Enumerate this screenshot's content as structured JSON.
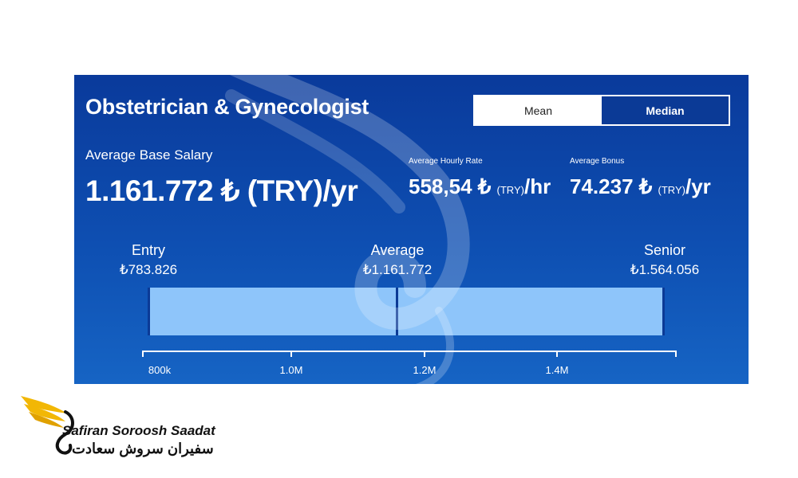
{
  "card": {
    "job_title": "Obstetrician & Gynecologist",
    "toggle": {
      "mean": "Mean",
      "median": "Median",
      "selected": "Median"
    },
    "base_salary": {
      "label": "Average Base Salary",
      "value": "1.161.772 ₺ (TRY)/yr"
    },
    "hourly": {
      "label": "Average Hourly Rate",
      "value": "558,54 ₺",
      "unit": "(TRY)",
      "suffix": "/hr"
    },
    "bonus": {
      "label": "Average Bonus",
      "value": "74.237 ₺",
      "unit": "(TRY)",
      "suffix": "/yr"
    },
    "levels": {
      "entry": {
        "label": "Entry",
        "amount": "₺783.826"
      },
      "average": {
        "label": "Average",
        "amount": "₺1.161.772"
      },
      "senior": {
        "label": "Senior",
        "amount": "₺1.564.056"
      }
    },
    "axis_ticks": [
      "800k",
      "1.0M",
      "1.2M",
      "1.4M"
    ],
    "salary_range": {
      "min": 783826,
      "average": 1161772,
      "max": 1564056
    },
    "colors": {
      "background": "#0e4fb2",
      "bar": "#8ec5fa",
      "accent": "#0b3a96"
    }
  },
  "logo": {
    "name_en": "Safiran Soroosh Saadat",
    "name_fa": "سفیران سروش سعادت",
    "icon": "wing-logo-icon",
    "colors": {
      "wing": "#f2b705",
      "text": "#111111"
    }
  }
}
